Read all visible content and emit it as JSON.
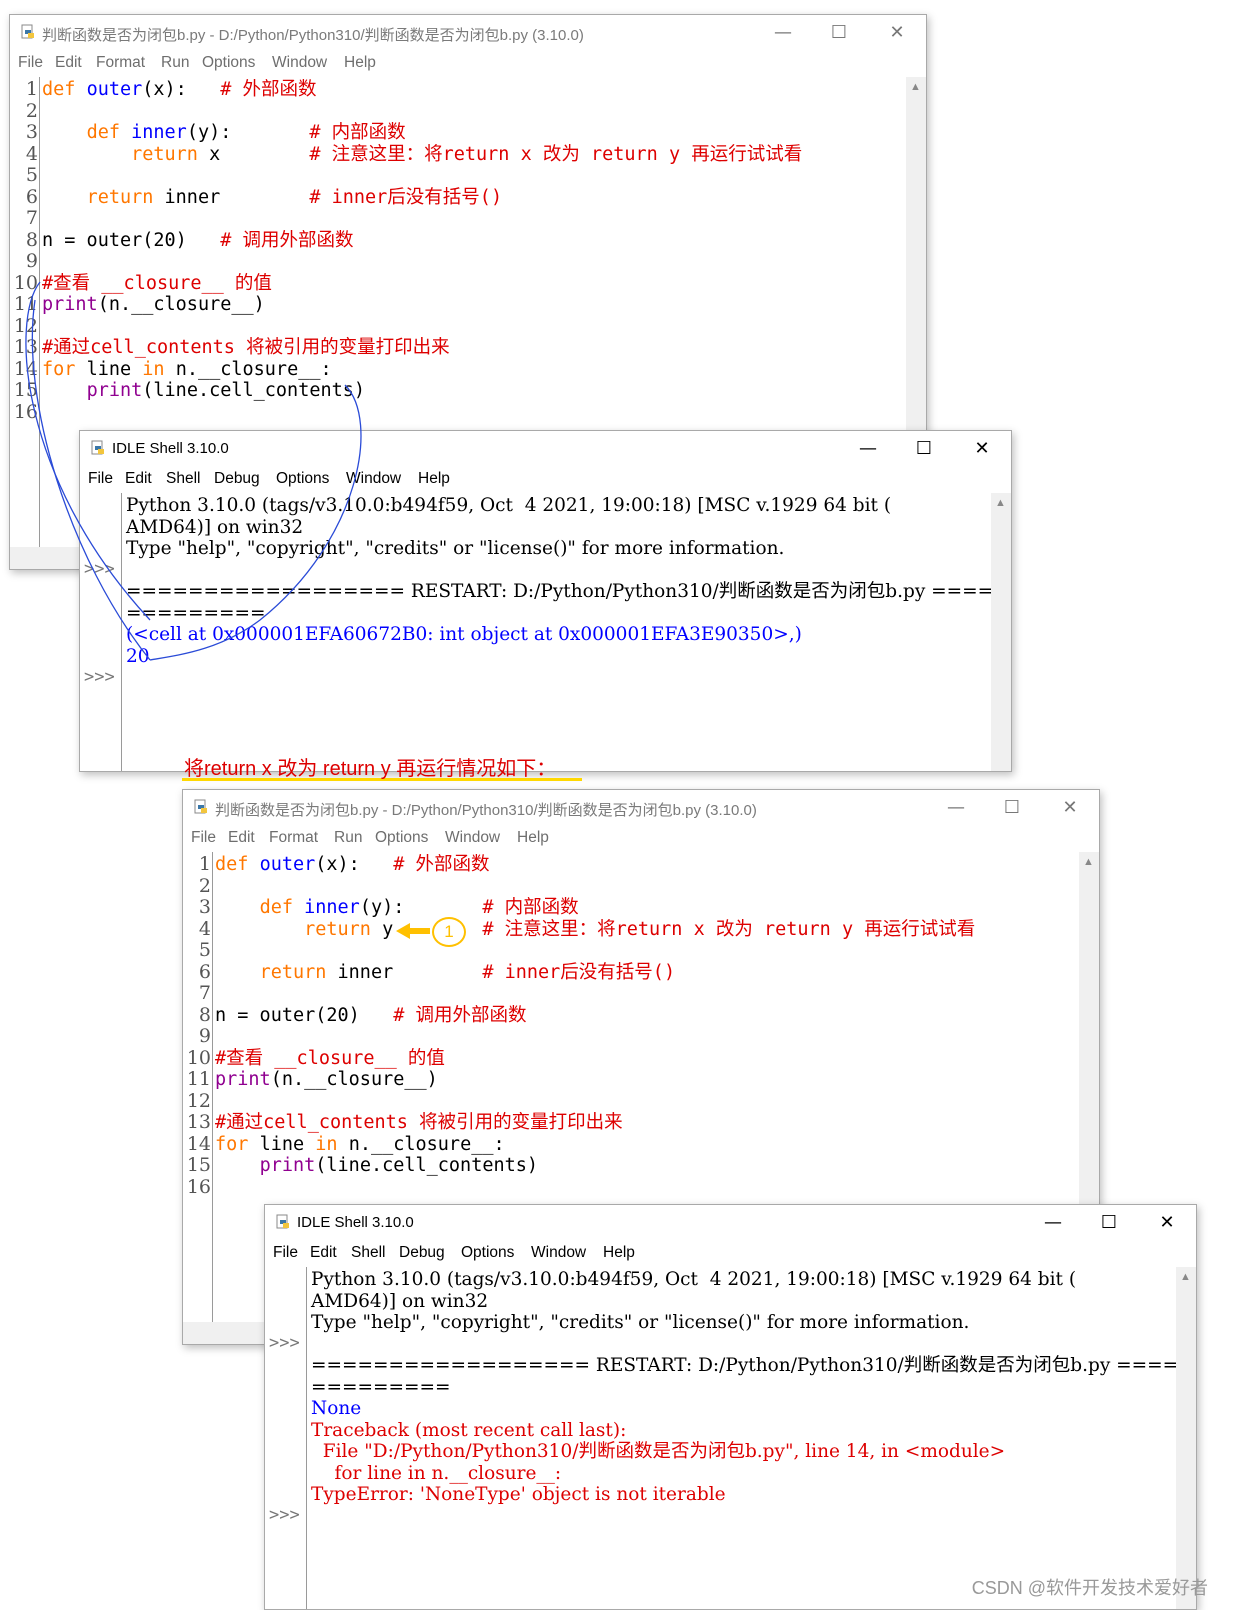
{
  "editor1": {
    "title": "判断函数是否为闭包b.py - D:/Python/Python310/判断函数是否为闭包b.py (3.10.0)",
    "menu": [
      "File",
      "Edit",
      "Format",
      "Run",
      "Options",
      "Window",
      "Help"
    ],
    "line_numbers": [
      "1",
      "2",
      "3",
      "4",
      "5",
      "6",
      "7",
      "8",
      "9",
      "10",
      "11",
      "12",
      "13",
      "14",
      "15",
      "16"
    ],
    "code": {
      "l1_kw": "def",
      "l1_fn": "outer",
      "l1_rest": "(x):",
      "l1_cm": "# 外部函数",
      "l3_kw": "def",
      "l3_fn": "inner",
      "l3_rest": "(y):",
      "l3_cm": "# 内部函数",
      "l4_kw": "return",
      "l4_rest": "x",
      "l4_cm": "# 注意这里：将return x 改为 return y 再运行试试看",
      "l6_kw": "return",
      "l6_rest": "inner",
      "l6_cm": "# inner后没有括号()",
      "l8_rest": "n = outer(20)",
      "l8_cm": "# 调用外部函数",
      "l10_cm": "#查看 __closure__ 的值",
      "l11_bi": "print",
      "l11_rest": "(n.__closure__)",
      "l13_cm": "#通过cell_contents 将被引用的变量打印出来",
      "l14_kw": "for",
      "l14_a": "line",
      "l14_kw2": "in",
      "l14_b": "n.__closure__:",
      "l15_bi": "print",
      "l15_rest": "(line.cell_contents)"
    }
  },
  "shell1": {
    "title": "IDLE Shell 3.10.0",
    "menu": [
      "File",
      "Edit",
      "Shell",
      "Debug",
      "Options",
      "Window",
      "Help"
    ],
    "prompt": ">>>",
    "lines": {
      "banner1": "Python 3.10.0 (tags/v3.10.0:b494f59, Oct  4 2021, 19:00:18) [MSC v.1929 64 bit (",
      "banner2": "AMD64)] on win32",
      "banner3": "Type \"help\", \"copyright\", \"credits\" or \"license()\" for more information.",
      "restart1": "================== RESTART: D:/Python/Python310/判断函数是否为闭包b.py =========",
      "restart2": "=========",
      "out1": "(<cell at 0x000001EFA60672B0: int object at 0x000001EFA3E90350>,)",
      "out2": "20"
    }
  },
  "caption": "将return x 改为 return y 再运行情况如下：",
  "editor2": {
    "title": "判断函数是否为闭包b.py - D:/Python/Python310/判断函数是否为闭包b.py (3.10.0)",
    "menu": [
      "File",
      "Edit",
      "Format",
      "Run",
      "Options",
      "Window",
      "Help"
    ],
    "line_numbers": [
      "1",
      "2",
      "3",
      "4",
      "5",
      "6",
      "7",
      "8",
      "9",
      "10",
      "11",
      "12",
      "13",
      "14",
      "15",
      "16"
    ],
    "code": {
      "l1_kw": "def",
      "l1_fn": "outer",
      "l1_rest": "(x):",
      "l1_cm": "# 外部函数",
      "l3_kw": "def",
      "l3_fn": "inner",
      "l3_rest": "(y):",
      "l3_cm": "# 内部函数",
      "l4_kw": "return",
      "l4_rest": "y",
      "l4_cm": "# 注意这里：将return x 改为 return y 再运行试试看",
      "l6_kw": "return",
      "l6_rest": "inner",
      "l6_cm": "# inner后没有括号()",
      "l8_rest": "n = outer(20)",
      "l8_cm": "# 调用外部函数",
      "l10_cm": "#查看 __closure__ 的值",
      "l11_bi": "print",
      "l11_rest": "(n.__closure__)",
      "l13_cm": "#通过cell_contents 将被引用的变量打印出来",
      "l14_kw": "for",
      "l14_a": "line",
      "l14_kw2": "in",
      "l14_b": "n.__closure__:",
      "l15_bi": "print",
      "l15_rest": "(line.cell_contents)"
    },
    "marker_number": "1"
  },
  "shell2": {
    "title": "IDLE Shell 3.10.0",
    "menu": [
      "File",
      "Edit",
      "Shell",
      "Debug",
      "Options",
      "Window",
      "Help"
    ],
    "prompt": ">>>",
    "lines": {
      "banner1": "Python 3.10.0 (tags/v3.10.0:b494f59, Oct  4 2021, 19:00:18) [MSC v.1929 64 bit (",
      "banner2": "AMD64)] on win32",
      "banner3": "Type \"help\", \"copyright\", \"credits\" or \"license()\" for more information.",
      "restart1": "================== RESTART: D:/Python/Python310/判断函数是否为闭包b.py =========",
      "restart2": "=========",
      "out1": "None",
      "tb1": "Traceback (most recent call last):",
      "tb2": "  File \"D:/Python/Python310/判断函数是否为闭包b.py\", line 14, in <module>",
      "tb3": "    for line in n.__closure__:",
      "tb4": "TypeError: 'NoneType' object is not iterable"
    }
  },
  "watermark": "CSDN @软件开发技术爱好者",
  "colors": {
    "keyword": "#ff7700",
    "definition": "#0000ff",
    "builtin": "#900090",
    "comment": "#dd0000",
    "shell_output": "#0000ff",
    "error": "#dd0000",
    "marker": "#ffc000"
  },
  "icons": [
    "python-file-icon",
    "minimize-icon",
    "maximize-icon",
    "close-icon",
    "scroll-up-arrow-icon",
    "arrow-left-icon"
  ]
}
